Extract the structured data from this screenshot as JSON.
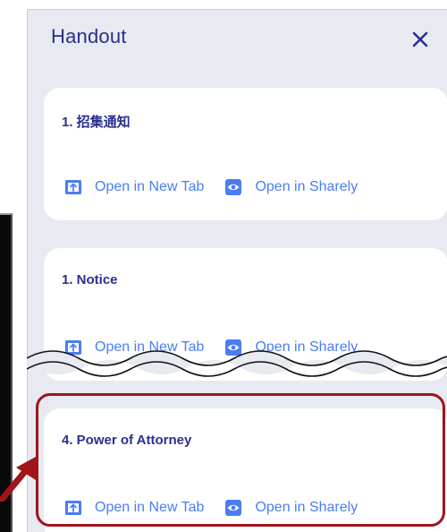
{
  "panel": {
    "title": "Handout",
    "close_symbol": "×"
  },
  "cards": [
    {
      "title": "1. 招集通知",
      "open_tab_label": "Open in New Tab",
      "open_sharely_label": "Open in Sharely"
    },
    {
      "title": "1. Notice",
      "open_tab_label": "Open in New Tab",
      "open_sharely_label": "Open in Sharely"
    },
    {
      "title": "4. Power of Attorney",
      "open_tab_label": "Open in New Tab",
      "open_sharely_label": "Open in Sharely"
    }
  ],
  "icons": {
    "open_tab": "new-tab-icon",
    "open_sharely": "eye-icon",
    "close": "close-icon",
    "pointer": "arrow-icon"
  },
  "colors": {
    "panel_background": "#e7eaf1",
    "title_text": "#2b2f8c",
    "link_text": "#4b7cf4",
    "highlight": "#a0141a"
  }
}
